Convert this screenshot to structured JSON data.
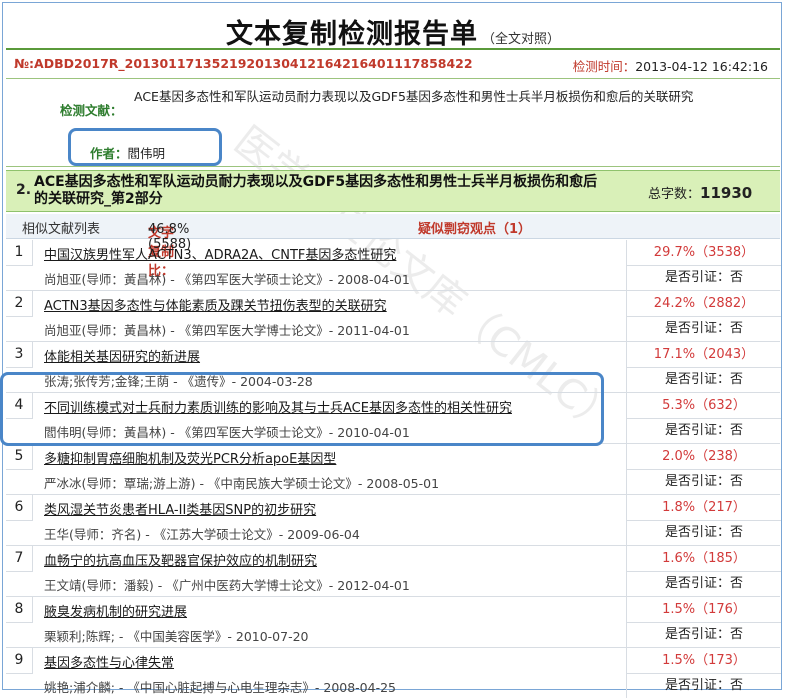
{
  "header": {
    "title": "文本复制检测报告单",
    "subtitle": "（全文对照）"
  },
  "report": {
    "id": "№:ADBD2017R_2013011713521920130412164216401117858422",
    "time_label": "检测时间：",
    "time_value": "2013-04-12 16:42:16",
    "doc_label": "检测文献：",
    "doc_title": "ACE基因多态性和军队运动员耐力表现以及GDF5基因多态性和男性士兵半月板损伤和愈后的关联研究",
    "author_label": "作者：",
    "author": "閻伟明"
  },
  "section": {
    "number": "2.",
    "title": "ACE基因多态性和军队运动员耐力表现以及GDF5基因多态性和男性士兵半月板损伤和愈后的关联研究_第2部分",
    "count_label": "总字数：",
    "count": "11930"
  },
  "stats": {
    "similar_list": "相似文献列表",
    "copy_label": "文字复制比：",
    "copy_value": "46.8%(5588)",
    "suspected": "疑似剽窃观点（1）"
  },
  "watermark": "医学学位论文库（CMLC）",
  "items": [
    {
      "n": "1",
      "title": "中国汉族男性军人ACTN3、ADRA2A、CNTF基因多态性研究",
      "meta": "尚旭亚(导师：黃昌林) - 《第四军医大学硕士论文》- 2008-04-01",
      "pct": "29.7%（3538）",
      "cite": "是否引证：否"
    },
    {
      "n": "2",
      "title": "ACTN3基因多态性与体能素质及踝关节扭伤表型的关联研究",
      "meta": "尚旭亚(导师：黃昌林) - 《第四军医大学博士论文》- 2011-04-01",
      "pct": "24.2%（2882）",
      "cite": "是否引证：否"
    },
    {
      "n": "3",
      "title": "体能相关基因研究的新进展",
      "meta": "张涛;张传芳;金锋;王荫 - 《遗传》- 2004-03-28",
      "pct": "17.1%（2043）",
      "cite": "是否引证：否"
    },
    {
      "n": "4",
      "title": "不同训练模式对士兵耐力素质训练的影响及其与士兵ACE基因多态性的相关性研究",
      "meta": "閻伟明(导师：黃昌林) - 《第四军医大学硕士论文》- 2010-04-01",
      "pct": "5.3%（632）",
      "cite": "是否引证：否"
    },
    {
      "n": "5",
      "title": "多糖抑制胃癌细胞机制及荧光PCR分析apoE基因型",
      "meta": "严冰冰(导师：覃瑞;游上游) - 《中南民族大学硕士论文》- 2008-05-01",
      "pct": "2.0%（238）",
      "cite": "是否引证：否"
    },
    {
      "n": "6",
      "title": "类风湿关节炎患者HLA-II类基因SNP的初步研究",
      "meta": "王华(导师：齐名) - 《江苏大学硕士论文》- 2009-06-04",
      "pct": "1.8%（217）",
      "cite": "是否引证：否"
    },
    {
      "n": "7",
      "title": "血畅宁的抗高血压及靶器官保护效应的机制研究",
      "meta": "王文靖(导师：潘毅) - 《广州中医药大学博士论文》- 2012-04-01",
      "pct": "1.6%（185）",
      "cite": "是否引证：否"
    },
    {
      "n": "8",
      "title": "腋臭发病机制的研究进展",
      "meta": "栗颖利;陈辉; - 《中国美容医学》- 2010-07-20",
      "pct": "1.5%（176）",
      "cite": "是否引证：否"
    },
    {
      "n": "9",
      "title": "基因多态性与心律失常",
      "meta": "姚艳;浦介麟; - 《中国心脏起搏与心电生理杂志》- 2008-04-25",
      "pct": "1.5%（173）",
      "cite": "是否引证：否"
    }
  ]
}
